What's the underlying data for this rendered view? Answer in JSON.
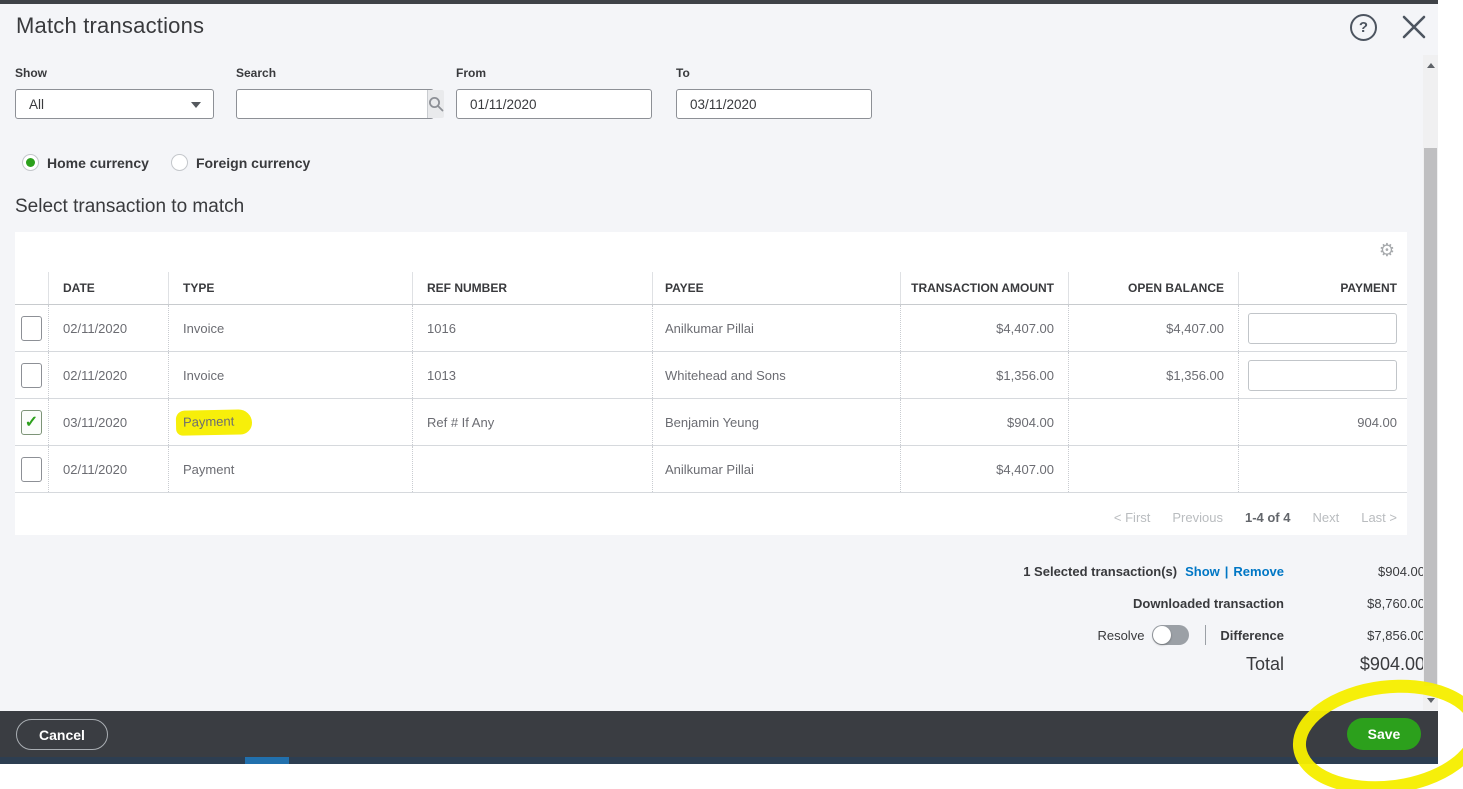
{
  "dialog": {
    "title": "Match transactions",
    "icons": {
      "help": "?",
      "close": "close",
      "gear": "⚙",
      "search": "magnifier"
    },
    "filters": {
      "show_label": "Show",
      "show_value": "All",
      "search_label": "Search",
      "search_value": "",
      "from_label": "From",
      "from_value": "01/11/2020",
      "to_label": "To",
      "to_value": "03/11/2020"
    },
    "currency": {
      "home_label": "Home currency",
      "foreign_label": "Foreign currency",
      "selected": "Home currency"
    },
    "section_title": "Select transaction to match",
    "table": {
      "headers": [
        "DATE",
        "TYPE",
        "REF NUMBER",
        "PAYEE",
        "TRANSACTION AMOUNT",
        "OPEN BALANCE",
        "PAYMENT"
      ],
      "rows": [
        {
          "checked": false,
          "date": "02/11/2020",
          "type": "Invoice",
          "ref": "1016",
          "payee": "Anilkumar Pillai",
          "amount": "$4,407.00",
          "open_balance": "$4,407.00",
          "payment": "",
          "payment_input": true,
          "highlight_type": false
        },
        {
          "checked": false,
          "date": "02/11/2020",
          "type": "Invoice",
          "ref": "1013",
          "payee": "Whitehead and Sons",
          "amount": "$1,356.00",
          "open_balance": "$1,356.00",
          "payment": "",
          "payment_input": true,
          "highlight_type": false
        },
        {
          "checked": true,
          "date": "03/11/2020",
          "type": "Payment",
          "ref": "Ref # If Any",
          "payee": "Benjamin Yeung",
          "amount": "$904.00",
          "open_balance": "",
          "payment": "904.00",
          "payment_input": false,
          "highlight_type": true
        },
        {
          "checked": false,
          "date": "02/11/2020",
          "type": "Payment",
          "ref": "",
          "payee": "Anilkumar Pillai",
          "amount": "$4,407.00",
          "open_balance": "",
          "payment": "",
          "payment_input": false,
          "highlight_type": false
        }
      ],
      "pagination": {
        "first": "< First",
        "previous": "Previous",
        "range": "1-4 of 4",
        "next": "Next",
        "last": "Last >"
      }
    },
    "summary": {
      "selected_label": "1 Selected transaction(s)",
      "show_link": "Show",
      "link_divider": "|",
      "remove_link": "Remove",
      "selected_amount": "$904.00",
      "downloaded_label": "Downloaded transaction",
      "downloaded_amount": "$8,760.00",
      "resolve_label": "Resolve",
      "difference_label": "Difference",
      "difference_amount": "$7,856.00",
      "total_label": "Total",
      "total_amount": "$904.00"
    },
    "footer": {
      "cancel_label": "Cancel",
      "save_label": "Save"
    },
    "colors": {
      "accent_green": "#2ca01c",
      "link_blue": "#0077c5",
      "footer_bg": "#3a3d42",
      "highlight_yellow": "#f7ef0a",
      "annotation_yellow": "#f6ee00",
      "hscroll_track": "#2d3e51",
      "hscroll_thumb": "#2170ad"
    }
  }
}
